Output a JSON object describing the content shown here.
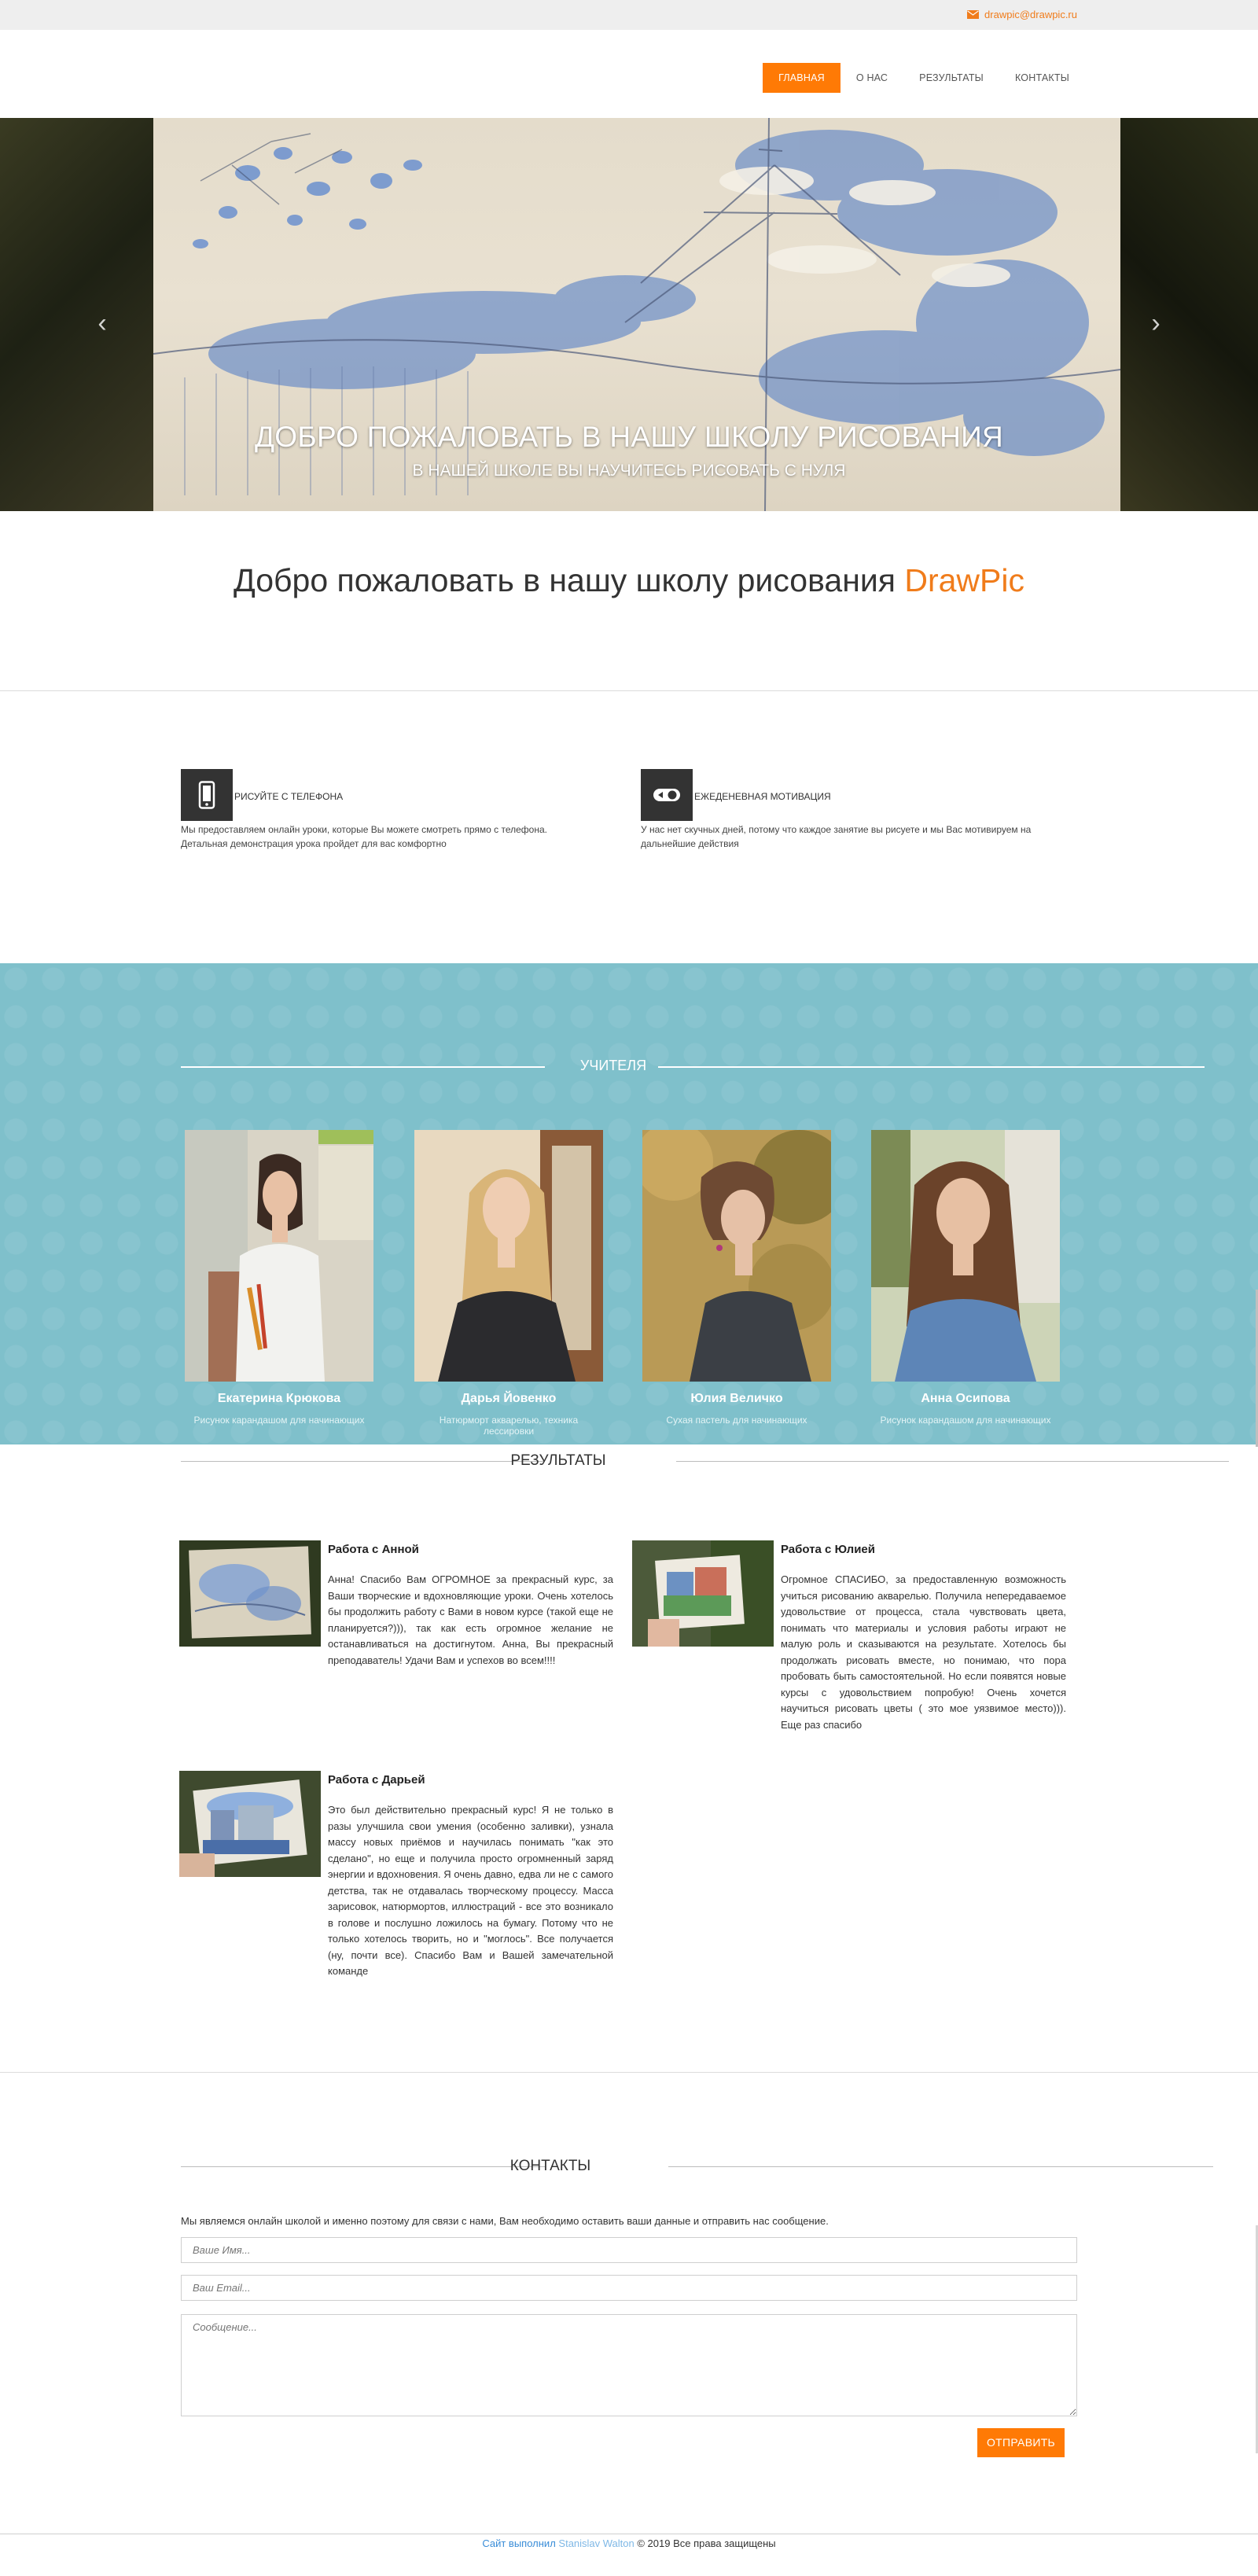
{
  "topbar": {
    "email": "drawpic@drawpic.ru",
    "icon": "envelope-icon",
    "accent": "#f07c1b"
  },
  "nav": {
    "items": [
      {
        "label": "ГЛАВНАЯ",
        "active": true
      },
      {
        "label": "О НАС",
        "active": false
      },
      {
        "label": "РЕЗУЛЬТАТЫ",
        "active": false
      },
      {
        "label": "КОНТАКТЫ",
        "active": false
      }
    ],
    "active_color": "#ff7a05"
  },
  "hero": {
    "title": "ДОБРО ПОЖАЛОВАТЬ В НАШУ ШКОЛУ РИСОВАНИЯ",
    "subtitle": "В НАШЕЙ ШКОЛЕ ВЫ НАУЧИТЕСЬ РИСОВАТЬ С НУЛЯ",
    "prev_icon": "chevron-left-icon",
    "next_icon": "chevron-right-icon",
    "slides_total": 3,
    "active_slide": 1
  },
  "welcome": {
    "text": "Добро пожаловать в нашу школу рисования ",
    "brand": "DrawPic",
    "brand_color": "#f07c1b"
  },
  "features": [
    {
      "icon": "smartphone-icon",
      "title": "РИСУЙТЕ С ТЕЛЕФОНА",
      "text": "Мы предоставляем онлайн уроки, которые Вы можете смотреть прямо с телефона. Детальная демонстрация урока пройдет для вас комфортно"
    },
    {
      "icon": "toggle-switch-icon",
      "title": "ЕЖЕДЕНЕВНАЯ МОТИВАЦИЯ",
      "text": "У нас нет скучных дней, потому что каждое занятие вы рисуете и мы Вас мотивируем на дальнейшие действия"
    }
  ],
  "teachers": {
    "heading": "УЧИТЕЛЯ",
    "bg_color": "#7fc0cb",
    "list": [
      {
        "name": "Екатерина Крюкова",
        "desc": "Рисунок карандашом для начинающих"
      },
      {
        "name": "Дарья Йовенко",
        "desc": "Натюрморт акварелью, техника лессировки"
      },
      {
        "name": "Юлия Величко",
        "desc": "Сухая пастель для начинающих"
      },
      {
        "name": "Анна Осипова",
        "desc": "Рисунок карандашом для начинающих"
      }
    ]
  },
  "results": {
    "heading": "РЕЗУЛЬТАТЫ",
    "reviews": [
      {
        "title": "Работа с Анной",
        "text": "Анна! Спасибо Вам ОГРОМНОЕ за прекрасный курс, за Ваши творческие и вдохновляющие уроки. Очень хотелось бы продолжить работу с Вами в новом курсе (такой еще не планируется?))), так как есть огромное желание не останавливаться на достигнутом. Анна, Вы прекрасный преподаватель! Удачи Вам и успехов во всем!!!!"
      },
      {
        "title": "Работа с Юлией",
        "text": "Огромное СПАСИБО, за предоставленную возможность учиться рисованию акварелью. Получила непередаваемое удовольствие от процесса, стала чувствовать цвета, понимать что материалы и условия работы играют не малую роль и сказываются на результате. Хотелось бы продолжать рисовать вместе, но понимаю, что пора пробовать быть самостоятельной. Но если появятся новые курсы с удовольствием попробую! Очень хочется научиться рисовать цветы ( это мое уязвимое место))). Еще раз спасибо"
      },
      {
        "title": "Работа с Дарьей",
        "text": "Это был действительно прекрасный курс! Я не только в разы улучшила свои умения (особенно заливки), узнала массу новых приёмов и научилась понимать \"как это сделано\", но еще и получила просто огромненный заряд энергии и вдохновения. Я очень давно, едва ли не с самого детства, так не отдавалась творческому процессу. Масса зарисовок, натюрмортов, иллюстраций - все это возникало в голове и послушно ложилось на бумагу. Потому что не только хотелось творить, но и \"моглось\". Все получается (ну, почти все). Спасибо Вам и Вашей замечательной команде"
      }
    ]
  },
  "contacts": {
    "heading": "КОНТАКТЫ",
    "intro": "Мы являемся онлайн школой и именно поэтому для связи с нами, Вам необходимо оставить ваши данные и отправить нас сообщение.",
    "name_placeholder": "Ваше Имя...",
    "email_placeholder": "Ваш Email...",
    "message_placeholder": "Сообщение...",
    "send_label": "ОТПРАВИТЬ"
  },
  "footer": {
    "made_by": "Сайт выполнил",
    "author": "Stanislav Walton",
    "rights": " © 2019 Все права защищены"
  }
}
